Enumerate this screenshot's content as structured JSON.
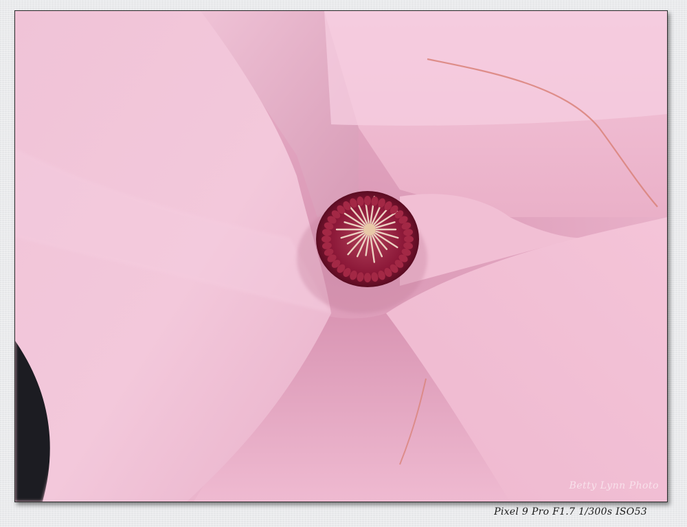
{
  "photo": {
    "subject": "pink magnolia flower close-up",
    "watermark": "Betty Lynn Photo",
    "caption": "Pixel 9 Pro F1.7 1/300s ISO53",
    "colors": {
      "petal_light": "#f3c6da",
      "petal_mid": "#e7a9c4",
      "petal_shadow": "#cf88a6",
      "stamen_dark": "#7a1030",
      "stamen_tip": "#f0d8c8"
    }
  }
}
